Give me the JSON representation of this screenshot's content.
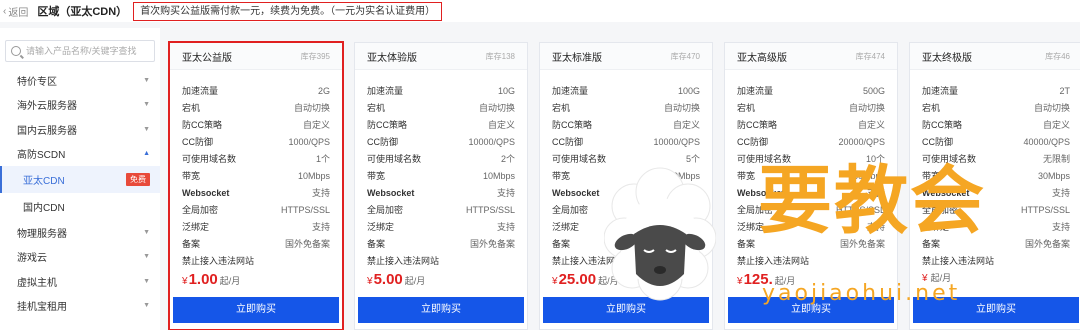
{
  "header": {
    "back_label": "返回",
    "title": "区域（亚太CDN）",
    "notice": "首次购买公益版需付款一元，续费为免费。（一元为实名认证费用）"
  },
  "sidebar": {
    "search_placeholder": "请输入产品名称/关键字查找",
    "items": [
      {
        "label": "特价专区"
      },
      {
        "label": "海外云服务器"
      },
      {
        "label": "国内云服务器"
      },
      {
        "label": "高防SCDN"
      }
    ],
    "sub_items": [
      {
        "label": "亚太CDN",
        "badge": "免费"
      },
      {
        "label": "国内CDN"
      }
    ],
    "items_after": [
      {
        "label": "物理服务器"
      },
      {
        "label": "游戏云"
      },
      {
        "label": "虚拟主机"
      },
      {
        "label": "挂机宝租用"
      }
    ]
  },
  "spec_labels": {
    "traffic": "加速流量",
    "downtime": "宕机",
    "anti_cc": "防CC策略",
    "cc": "CC防御",
    "domains": "可使用域名数",
    "bandwidth": "带宽",
    "websocket": "Websocket",
    "https": "全局加密",
    "wildcard": "泛绑定",
    "icp": "备案",
    "prohibited": "禁止接入违法网站",
    "unit": "起/月",
    "currency": "¥",
    "buy": "立即购买"
  },
  "cards": [
    {
      "name": "亚太公益版",
      "stock": "库存395",
      "traffic": "2G",
      "downtime": "自动切换",
      "anti_cc": "自定义",
      "cc": "1000/QPS",
      "domains": "1个",
      "bandwidth": "10Mbps",
      "websocket": "支持",
      "https": "HTTPS/SSL",
      "wildcard": "支持",
      "icp": "国外免备案",
      "price": "1.00"
    },
    {
      "name": "亚太体验版",
      "stock": "库存138",
      "traffic": "10G",
      "downtime": "自动切换",
      "anti_cc": "自定义",
      "cc": "10000/QPS",
      "domains": "2个",
      "bandwidth": "10Mbps",
      "websocket": "支持",
      "https": "HTTPS/SSL",
      "wildcard": "支持",
      "icp": "国外免备案",
      "price": "5.00"
    },
    {
      "name": "亚太标准版",
      "stock": "库存470",
      "traffic": "100G",
      "downtime": "自动切换",
      "anti_cc": "自定义",
      "cc": "10000/QPS",
      "domains": "5个",
      "bandwidth": "20Mbps",
      "websocket": "支持",
      "https": "HTTPS/SSL",
      "wildcard": "支持",
      "icp": "国外免备案",
      "price": "25.00"
    },
    {
      "name": "亚太高级版",
      "stock": "库存474",
      "traffic": "500G",
      "downtime": "自动切换",
      "anti_cc": "自定义",
      "cc": "20000/QPS",
      "domains": "10个",
      "bandwidth": "30Mbps",
      "websocket": "支持",
      "https": "HTTPS/SSL",
      "wildcard": "支持",
      "icp": "国外免备案",
      "price": "125."
    },
    {
      "name": "亚太终极版",
      "stock": "库存46",
      "traffic": "2T",
      "downtime": "自动切换",
      "anti_cc": "自定义",
      "cc": "40000/QPS",
      "domains": "无限制",
      "bandwidth": "30Mbps",
      "websocket": "支持",
      "https": "HTTPS/SSL",
      "wildcard": "支持",
      "icp": "国外免备案",
      "price": ""
    }
  ],
  "watermark": {
    "text": "要教会",
    "url": "yaojiaohui.net",
    "color": "#f5a623"
  },
  "colors": {
    "accent": "#1556e8",
    "alert": "#e02020",
    "badge": "#e84a3a"
  }
}
